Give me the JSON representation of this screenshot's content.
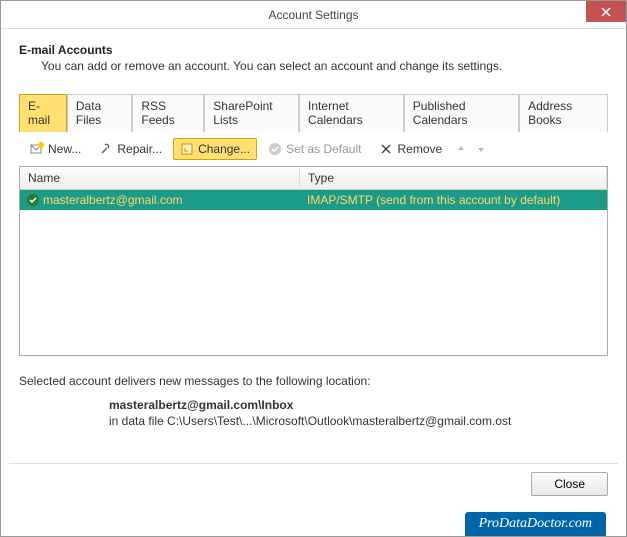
{
  "window": {
    "title": "Account Settings"
  },
  "header": {
    "title": "E-mail Accounts",
    "description": "You can add or remove an account. You can select an account and change its settings."
  },
  "tabs": [
    {
      "label": "E-mail",
      "active": true
    },
    {
      "label": "Data Files"
    },
    {
      "label": "RSS Feeds"
    },
    {
      "label": "SharePoint Lists"
    },
    {
      "label": "Internet Calendars"
    },
    {
      "label": "Published Calendars"
    },
    {
      "label": "Address Books"
    }
  ],
  "toolbar": {
    "new": "New...",
    "repair": "Repair...",
    "change": "Change...",
    "set_default": "Set as Default",
    "remove": "Remove"
  },
  "table": {
    "headers": {
      "name": "Name",
      "type": "Type"
    },
    "rows": [
      {
        "name": "masteralbertz@gmail.com",
        "type": "IMAP/SMTP (send from this account by default)"
      }
    ]
  },
  "delivery": {
    "intro": "Selected account delivers new messages to the following location:",
    "location": "masteralbertz@gmail.com\\Inbox",
    "datafile": "in data file C:\\Users\\Test\\...\\Microsoft\\Outlook\\masteralbertz@gmail.com.ost"
  },
  "footer": {
    "close": "Close"
  },
  "watermark": "ProDataDoctor.com"
}
